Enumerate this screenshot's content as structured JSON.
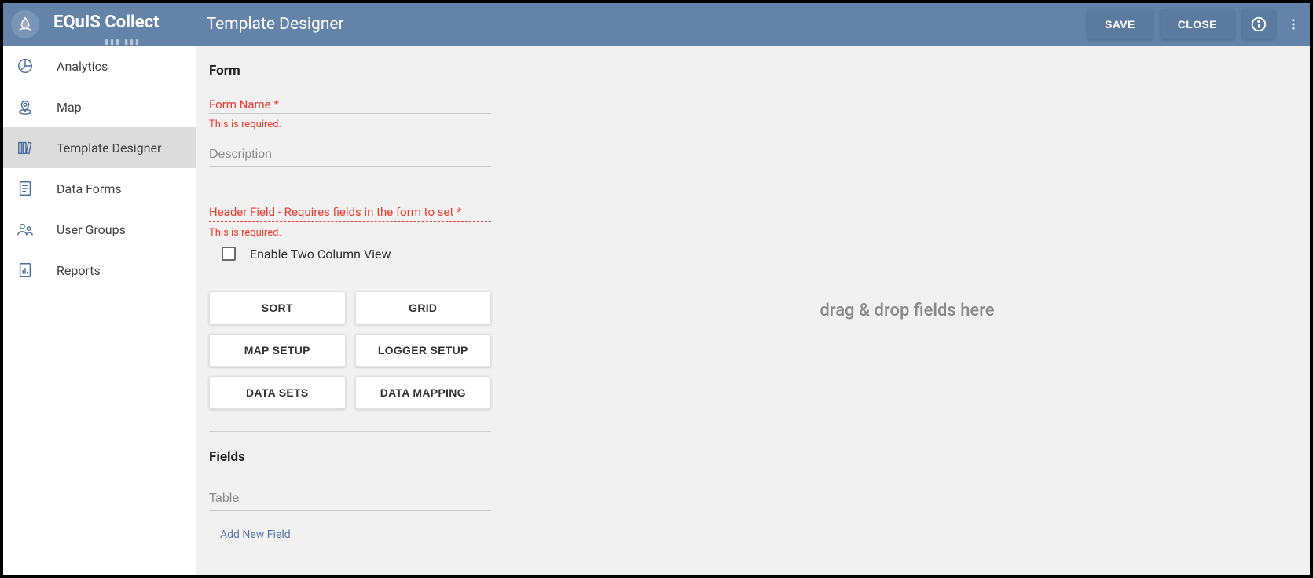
{
  "header": {
    "app_name": "EQuIS Collect",
    "page_title": "Template Designer",
    "save_label": "SAVE",
    "close_label": "CLOSE"
  },
  "sidebar": {
    "items": [
      {
        "label": "Analytics",
        "icon": "pie-chart-icon",
        "active": false
      },
      {
        "label": "Map",
        "icon": "map-pin-icon",
        "active": false
      },
      {
        "label": "Template Designer",
        "icon": "books-icon",
        "active": true
      },
      {
        "label": "Data Forms",
        "icon": "document-icon",
        "active": false
      },
      {
        "label": "User Groups",
        "icon": "user-groups-icon",
        "active": false
      },
      {
        "label": "Reports",
        "icon": "bar-chart-doc-icon",
        "active": false
      }
    ]
  },
  "form_panel": {
    "section_form": "Form",
    "form_name_label": "Form Name *",
    "required_msg": "This is required.",
    "description_placeholder": "Description",
    "header_field_label": "Header Field - Requires fields in the form to set *",
    "two_col_label": "Enable Two Column View",
    "buttons": {
      "sort": "SORT",
      "grid": "GRID",
      "map_setup": "MAP SETUP",
      "logger_setup": "LOGGER SETUP",
      "data_sets": "DATA SETS",
      "data_mapping": "DATA MAPPING"
    },
    "section_fields": "Fields",
    "table_placeholder": "Table",
    "add_field_label": "Add New Field"
  },
  "canvas": {
    "placeholder": "drag & drop fields here"
  }
}
